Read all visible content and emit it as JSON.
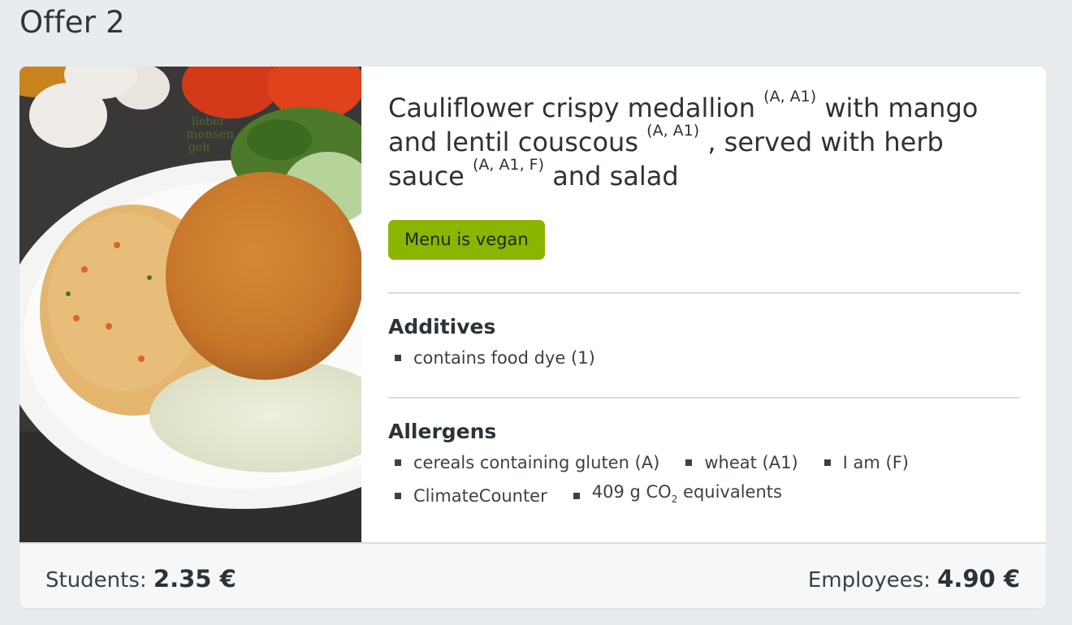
{
  "page_title": "Offer 2",
  "meal": {
    "title_parts": [
      {
        "text": "Cauliflower crispy medallion ",
        "sup": "(A, A1)"
      },
      {
        "text": " with mango and lentil couscous ",
        "sup": "(A, A1)"
      },
      {
        "text": " , served with herb sauce ",
        "sup": "(A, A1, F)"
      },
      {
        "text": " and salad",
        "sup": ""
      }
    ],
    "vegan_label": "Menu is vegan",
    "badge_color": "#8cb500"
  },
  "additives": {
    "heading": "Additives",
    "items": [
      "contains food dye (1)"
    ]
  },
  "allergens": {
    "heading": "Allergens",
    "items": [
      "cereals containing gluten (A)",
      "wheat (A1)",
      "I am (F)"
    ],
    "climate_label": "ClimateCounter",
    "co2_prefix": "409 g CO",
    "co2_sub": "2",
    "co2_suffix": " equivalents"
  },
  "prices": {
    "students_label": "Students:",
    "students_value": "2.35 €",
    "employees_label": "Employees:",
    "employees_value": "4.90 €"
  },
  "photo": {
    "plate_text_1": "lieber",
    "plate_text_2": "mensen",
    "plate_text_3": "geh"
  }
}
